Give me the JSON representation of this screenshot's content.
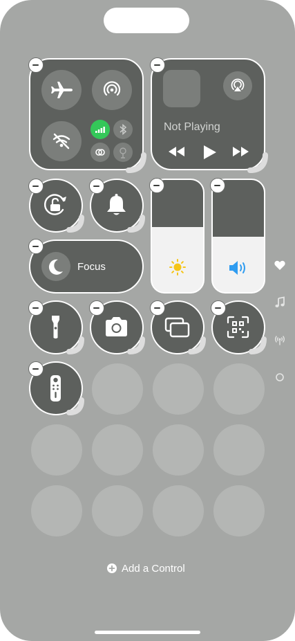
{
  "media": {
    "status": "Not Playing"
  },
  "focus": {
    "label": "Focus"
  },
  "footer": {
    "add_control_label": "Add a Control"
  },
  "colors": {
    "cellular_active": "#34c759",
    "volume_accent": "#2f9cf0",
    "brightness_accent": "#f5c518"
  },
  "icons": [
    "airplane-icon",
    "airdrop-icon",
    "wifi-off-icon",
    "cellular-icon",
    "bluetooth-icon",
    "personal-hotspot-icon",
    "satellite-icon",
    "rewind-icon",
    "play-icon",
    "fast-forward-icon",
    "rotation-lock-icon",
    "bell-icon",
    "moon-icon",
    "sun-icon",
    "speaker-icon",
    "flashlight-icon",
    "camera-icon",
    "screen-mirroring-icon",
    "qr-code-icon",
    "apple-tv-remote-icon",
    "heart-icon",
    "music-note-icon",
    "antenna-icon",
    "circle-icon"
  ]
}
